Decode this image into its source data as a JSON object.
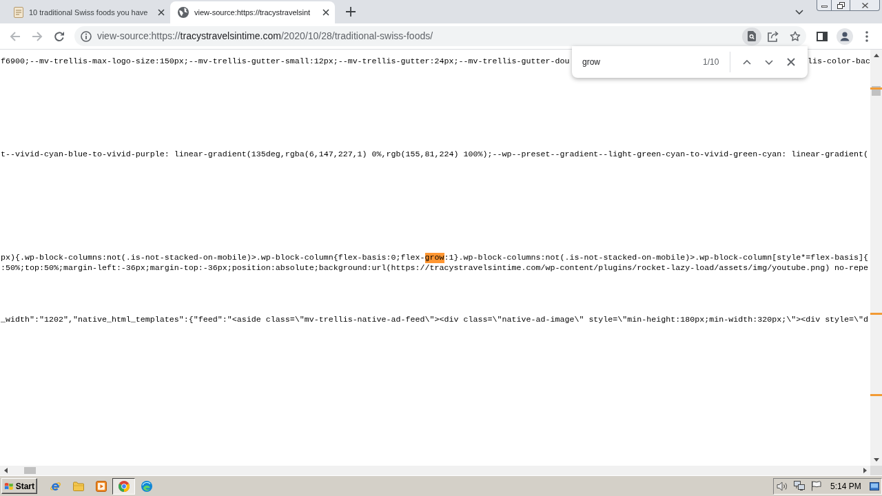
{
  "browser_tabs": [
    {
      "title": "10 traditional Swiss foods you have",
      "selected": false,
      "kind": "site"
    },
    {
      "title": "view-source:https://tracystravelsint",
      "selected": true,
      "kind": "default"
    }
  ],
  "toolbar": {
    "back": {
      "disabled": true
    },
    "forward": {
      "disabled": true
    },
    "find_in_page": {
      "active": true
    }
  },
  "address_bar": {
    "url_prefix": "view-source:https://",
    "url_host": "tracystravelsintime.com",
    "url_path": "/2020/10/28/traditional-swiss-foods/"
  },
  "find_bar": {
    "query": "grow",
    "count": "1/10"
  },
  "source_lines": [
    {
      "segments": [
        {
          "text": "f6900;--mv-trellis-max-logo-size:150px;--mv-trellis-gutter-small:12px;--mv-trellis-gutter:24px;--mv-trellis-gutter-dou",
          "highlighted": false
        }
      ],
      "after_find_bar": [
        {
          "text": "lis-color-bac",
          "highlighted": false
        }
      ]
    },
    {
      "segments": [
        {
          "text": "t--vivid-cyan-blue-to-vivid-purple: linear-gradient(135deg,rgba(6,147,227,1) 0%,rgb(155,81,224) 100%);--wp--preset--gradient--light-green-cyan-to-vivid-green-cyan: linear-gradient(",
          "highlighted": false
        }
      ]
    },
    {
      "segments": [
        {
          "text": "px){.wp-block-columns:not(.is-not-stacked-on-mobile)>.wp-block-column{flex-basis:0;flex-",
          "highlighted": false
        },
        {
          "text": "grow",
          "highlighted": true
        },
        {
          "text": ":1}.wp-block-columns:not(.is-not-stacked-on-mobile)>.wp-block-column[style*=flex-basis]{",
          "highlighted": false
        }
      ]
    },
    {
      "segments": [
        {
          "text": ":50%;top:50%;margin-left:-36px;margin-top:-36px;position:absolute;background:url(https://tracystravelsintime.com/wp-content/plugins/rocket-lazy-load/assets/img/youtube.png) no-repe",
          "highlighted": false
        }
      ]
    },
    {
      "segments": [
        {
          "text": "_width\":\"1202\",\"native_html_templates\":{\"feed\":\"<aside class=\\\"mv-trellis-native-ad-feed\\\"><div class=\\\"native-ad-image\\\" style=\\\"min-height:180px;min-width:320px;\\\"><div style=\\\"d",
          "highlighted": false
        }
      ]
    }
  ],
  "taskbar": {
    "start_label": "Start",
    "apps": [
      {
        "selected": false
      },
      {
        "selected": false
      },
      {
        "selected": false
      },
      {
        "selected": true
      },
      {
        "selected": false
      }
    ],
    "clock": "5:14 PM"
  }
}
